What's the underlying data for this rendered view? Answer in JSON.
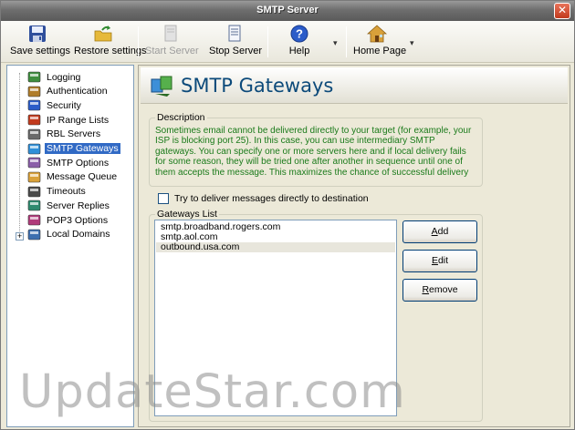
{
  "window": {
    "title": "SMTP Server",
    "close_label": "✕"
  },
  "toolbar": {
    "save": "Save settings",
    "restore": "Restore settings",
    "start": "Start Server",
    "stop": "Stop Server",
    "help": "Help",
    "home": "Home Page",
    "dropdown": "▾"
  },
  "tree": {
    "items": [
      {
        "label": "Logging",
        "icon": "logging-icon"
      },
      {
        "label": "Authentication",
        "icon": "authentication-icon"
      },
      {
        "label": "Security",
        "icon": "security-icon"
      },
      {
        "label": "IP Range Lists",
        "icon": "ip-range-icon"
      },
      {
        "label": "RBL Servers",
        "icon": "rbl-icon"
      },
      {
        "label": "SMTP Gateways",
        "icon": "gateways-icon",
        "selected": true
      },
      {
        "label": "SMTP Options",
        "icon": "options-icon"
      },
      {
        "label": "Message Queue",
        "icon": "queue-icon"
      },
      {
        "label": "Timeouts",
        "icon": "timeouts-icon"
      },
      {
        "label": "Server Replies",
        "icon": "replies-icon"
      },
      {
        "label": "POP3 Options",
        "icon": "pop3-icon"
      },
      {
        "label": "Local Domains",
        "icon": "domains-icon"
      }
    ],
    "expander": "+"
  },
  "panel": {
    "title": "SMTP Gateways",
    "description_legend": "Description",
    "description": "Sometimes email cannot be delivered directly to your target (for example, your ISP is blocking port 25). In this case, you can use intermediary SMTP gateways. You can specify one or more servers here and if local delivery fails for some reason, they will be tried one after another in sequence until one of them accepts the message. This maximizes the chance of successful delivery",
    "checkbox_label": "Try to deliver messages directly to destination",
    "checkbox_checked": false,
    "gateways_legend": "Gateways List",
    "gateways": [
      "smtp.broadband.rogers.com",
      "smtp.aol.com",
      "outbound.usa.com"
    ],
    "add_mn": "A",
    "add_rest": "dd",
    "edit_mn": "E",
    "edit_rest": "dit",
    "remove_mn": "R",
    "remove_rest": "emove"
  },
  "watermark": "UpdateStar.com",
  "colors": {
    "accent": "#316ac5",
    "description_text": "#1a7a1a",
    "banner_title": "#0c4a7a"
  }
}
